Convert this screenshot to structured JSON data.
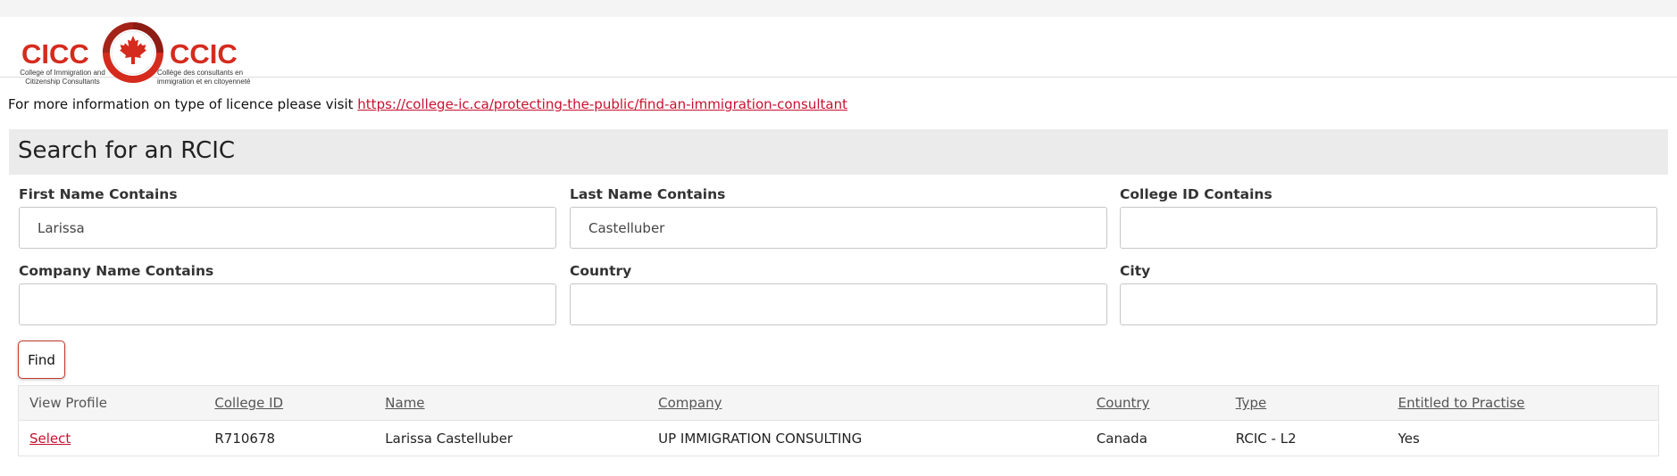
{
  "logo": {
    "abbr_en": "CICC",
    "abbr_fr": "CCIC",
    "name_en": "College of Immigration and Citizenship Consultants",
    "name_fr": "Collège des consultants en immigration et en citoyenneté",
    "brand_color": "#d52b1e",
    "icon": "maple-leaf-seal-icon"
  },
  "info": {
    "text": "For more information on type of licence please visit ",
    "link_text": "https://college-ic.ca/protecting-the-public/find-an-immigration-consultant"
  },
  "search": {
    "title": "Search for an RCIC",
    "fields": {
      "first_name": {
        "label": "First Name Contains",
        "value": "Larissa"
      },
      "last_name": {
        "label": "Last Name Contains",
        "value": "Castelluber"
      },
      "college_id": {
        "label": "College ID Contains",
        "value": ""
      },
      "company": {
        "label": "Company Name Contains",
        "value": ""
      },
      "country": {
        "label": "Country",
        "value": ""
      },
      "city": {
        "label": "City",
        "value": ""
      }
    },
    "find_label": "Find"
  },
  "results": {
    "headers": {
      "view_profile": "View Profile",
      "college_id": "College ID",
      "name": "Name",
      "company": "Company",
      "country": "Country",
      "type": "Type",
      "entitled": "Entitled to Practise"
    },
    "rows": [
      {
        "select": "Select",
        "college_id": "R710678",
        "name": "Larissa Castelluber",
        "company": "UP IMMIGRATION CONSULTING",
        "country": "Canada",
        "type": "RCIC - L2",
        "entitled": "Yes"
      }
    ]
  },
  "colors": {
    "link": "#c8102e",
    "section_bg": "#ebebeb",
    "table_header_bg": "#f5f5f5"
  }
}
